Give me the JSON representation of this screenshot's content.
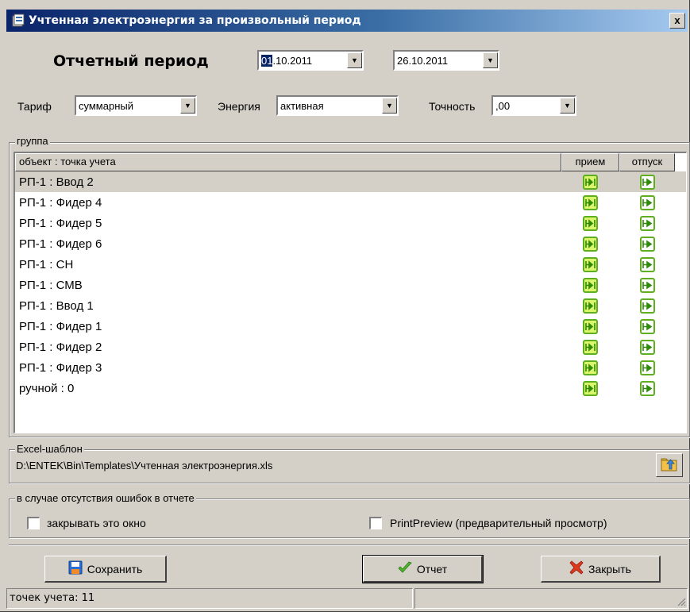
{
  "window": {
    "title": "Учтенная электроэнергия за произвольный период",
    "close_label": "x"
  },
  "period": {
    "label": "Отчетный период",
    "date_from_day": "01",
    "date_from_rest": ".10.2011",
    "date_to": "26.10.2011"
  },
  "filters": {
    "tariff_label": "Тариф",
    "tariff_value": "суммарный",
    "energy_label": "Энергия",
    "energy_value": "активная",
    "precision_label": "Точность",
    "precision_value": ",00"
  },
  "group": {
    "legend": "группа",
    "columns": [
      "объект : точка учета",
      "прием",
      "отпуск"
    ],
    "rows": [
      {
        "name": "РП-1 : Ввод 2",
        "selected": true
      },
      {
        "name": "РП-1 : Фидер 4"
      },
      {
        "name": "РП-1 : Фидер 5"
      },
      {
        "name": "РП-1 : Фидер 6"
      },
      {
        "name": "РП-1 : СН"
      },
      {
        "name": "РП-1 : СМВ"
      },
      {
        "name": "РП-1 : Ввод 1"
      },
      {
        "name": "РП-1 : Фидер 1"
      },
      {
        "name": "РП-1 : Фидер 2"
      },
      {
        "name": "РП-1 : Фидер 3"
      },
      {
        "name": "ручной : 0"
      }
    ]
  },
  "template": {
    "legend": "Excel-шаблон",
    "path": "D:\\ENTEK\\Bin\\Templates\\Учтенная электроэнергия.xls"
  },
  "no_errors": {
    "legend": "в случае отсутствия ошибок в отчете",
    "close_window_label": "закрывать это окно",
    "close_window_checked": false,
    "print_preview_label": "PrintPreview (предварительный просмотр)",
    "print_preview_checked": false
  },
  "buttons": {
    "save": "Сохранить",
    "report": "Отчет",
    "close": "Закрыть"
  },
  "status": {
    "points": "точек учета: 11",
    "pane2": ""
  },
  "colors": {
    "title_start": "#0a246a",
    "title_end": "#a6caf0",
    "face": "#d4d0c8",
    "meter_green": "#5fae1f",
    "meter_fill": "#d9f66c"
  }
}
